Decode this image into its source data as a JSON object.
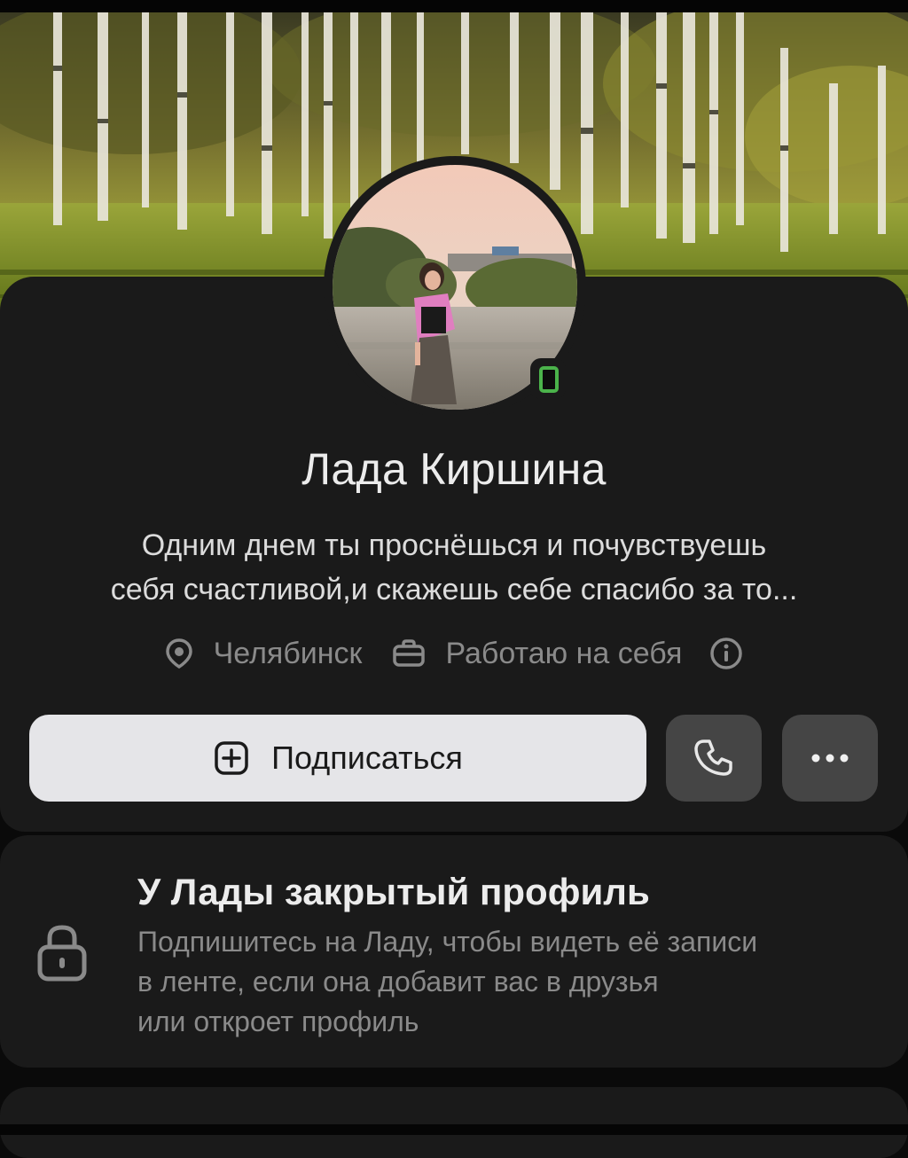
{
  "profile": {
    "name": "Лада Киршина",
    "status_line1": "Одним днем ты проснёшься и почувствуешь",
    "status_line2": "себя счастливой,и скажешь себе спасибо за то...",
    "city": "Челябинск",
    "work": "Работаю на себя",
    "online_indicator": "mobile-online",
    "online_color": "#4bb34b"
  },
  "actions": {
    "subscribe_label": "Подписаться",
    "call_icon": "phone-icon",
    "more_icon": "more-horizontal-icon"
  },
  "private_profile": {
    "title": "У Лады закрытый профиль",
    "desc_line1": "Подпишитесь на Ладу, чтобы видеть её записи",
    "desc_line2": "в ленте, если она добавит вас в друзья",
    "desc_line3": "или откроет профиль"
  },
  "icons": {
    "location": "location-pin-icon",
    "work": "briefcase-icon",
    "info": "info-icon",
    "lock": "lock-icon",
    "subscribe": "plus-square-icon"
  }
}
